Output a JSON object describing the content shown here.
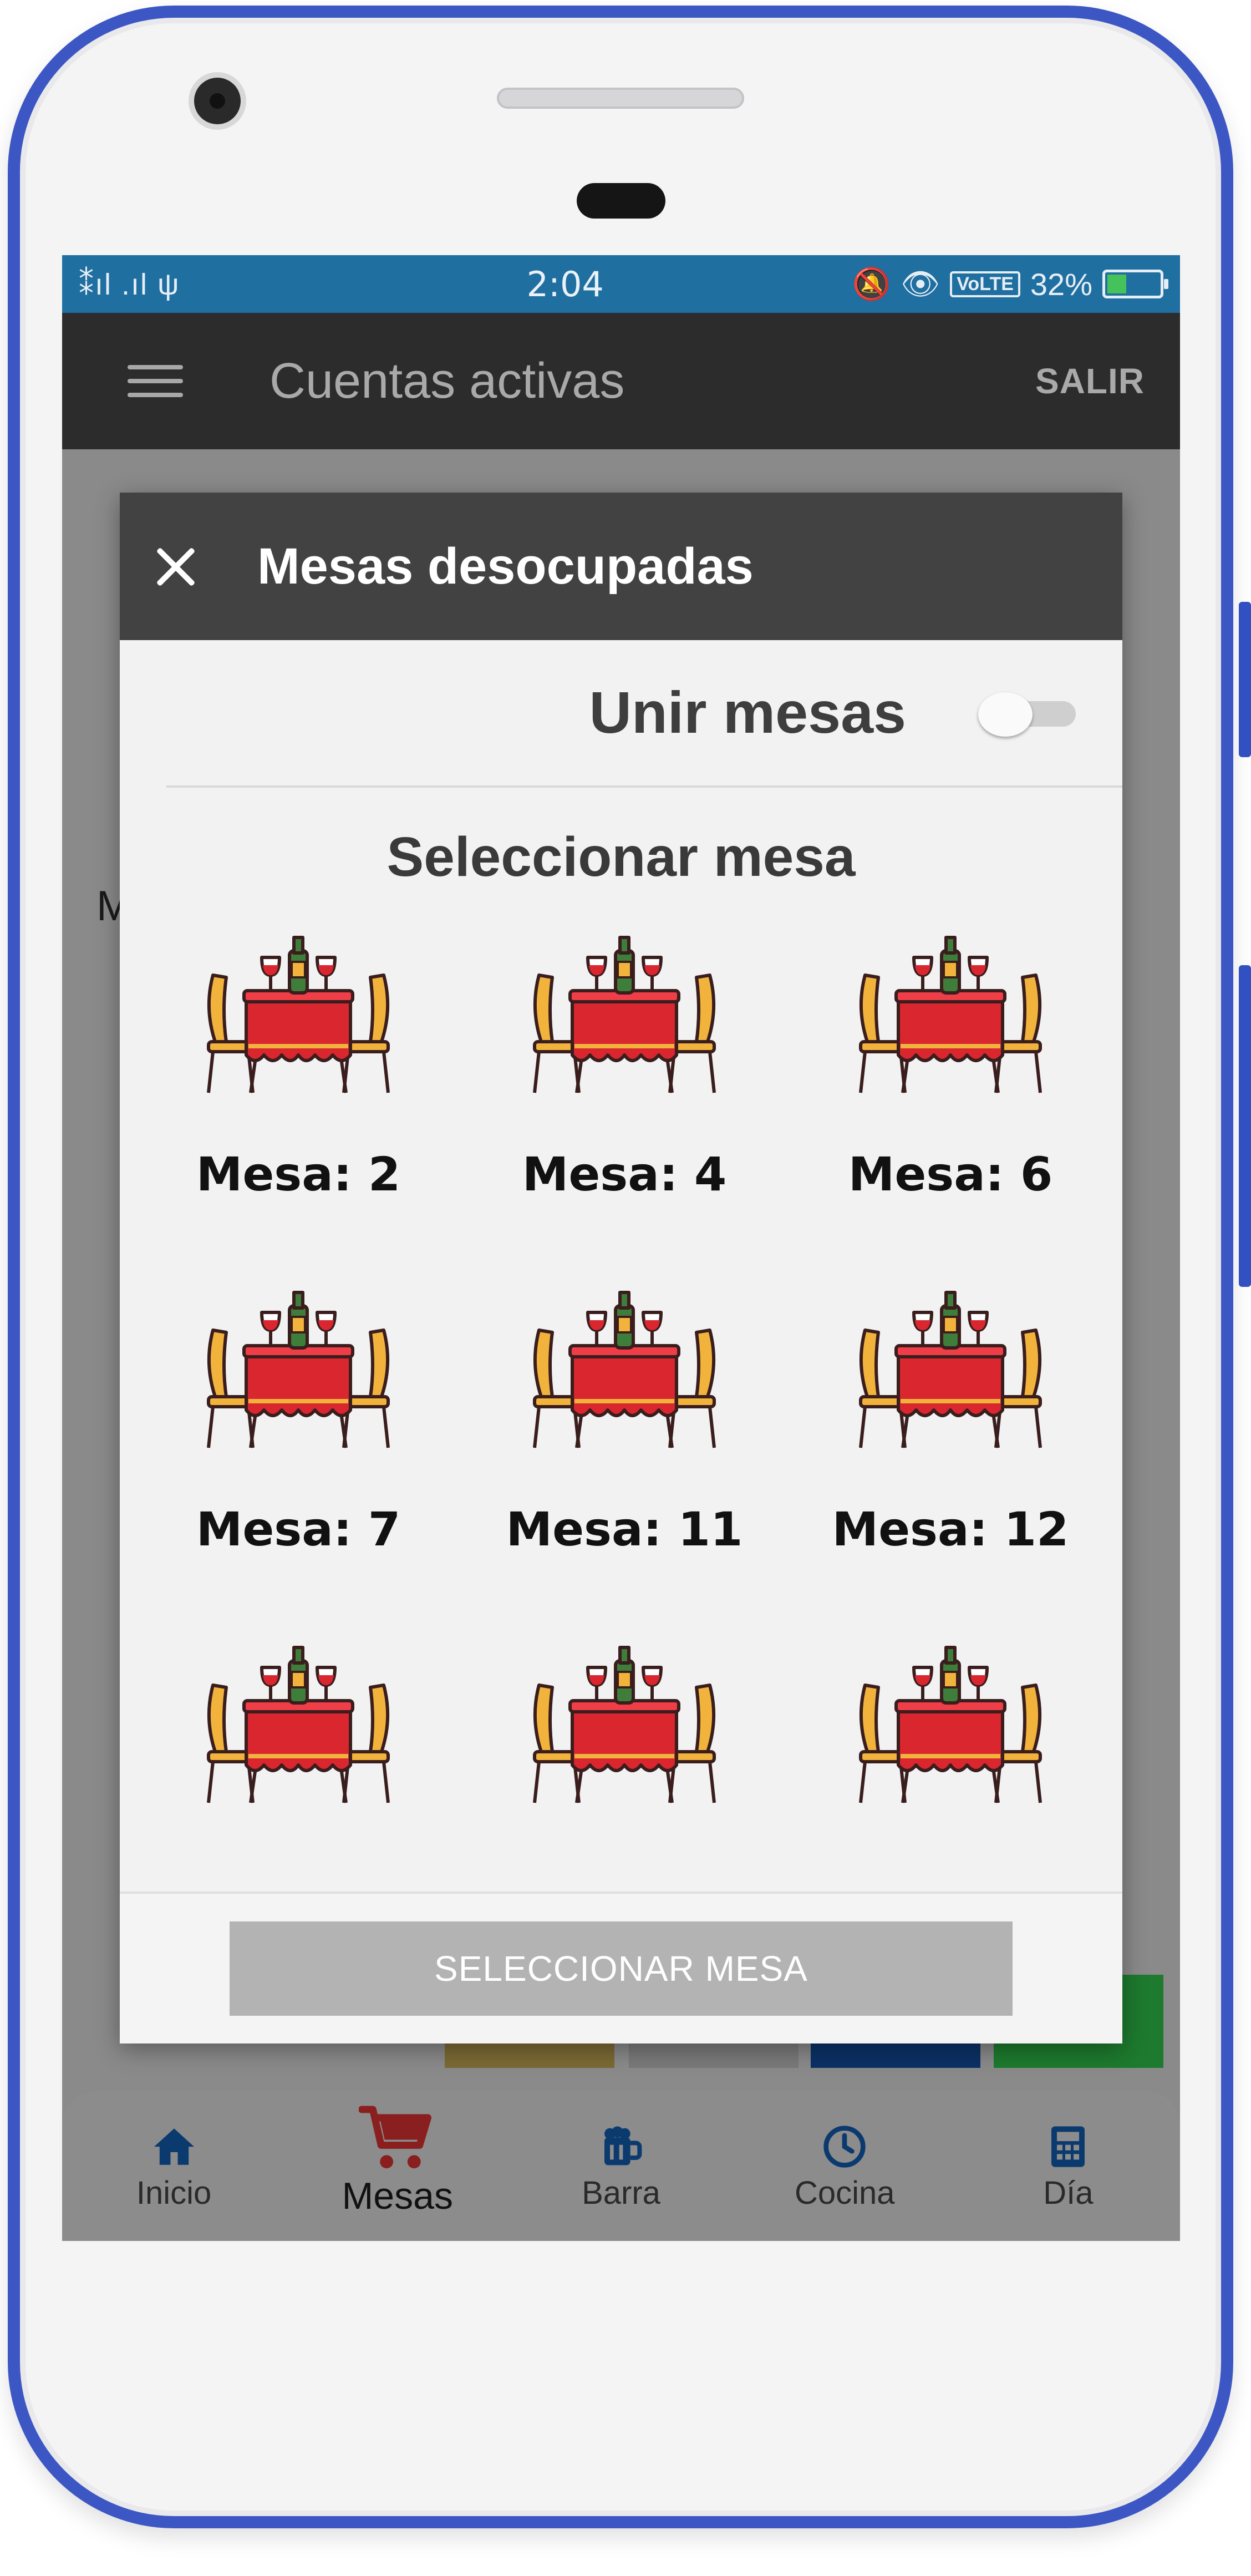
{
  "status_bar": {
    "left_icons": "⁑ıl .ıl ψ",
    "time": "2:04",
    "network": "VoLTE",
    "battery": "32%",
    "battery_level": 0.32
  },
  "app_bar": {
    "title": "Cuentas activas",
    "logout_label": "SALIR"
  },
  "background": {
    "visible_fragment": "M"
  },
  "dialog": {
    "title": "Mesas desocupadas",
    "join_tables_label": "Unir mesas",
    "join_tables_on": false,
    "section_heading": "Seleccionar mesa",
    "tables": [
      {
        "label": "Mesa: 2"
      },
      {
        "label": "Mesa: 4"
      },
      {
        "label": "Mesa: 6"
      },
      {
        "label": "Mesa: 7"
      },
      {
        "label": "Mesa: 11"
      },
      {
        "label": "Mesa: 12"
      },
      {
        "label": ""
      },
      {
        "label": ""
      },
      {
        "label": ""
      }
    ],
    "select_button_label": "SELECCIONAR MESA"
  },
  "bottom_nav": {
    "items": [
      {
        "label": "Inicio",
        "icon": "home-icon"
      },
      {
        "label": "Mesas",
        "icon": "cart-icon",
        "active": true
      },
      {
        "label": "Barra",
        "icon": "beer-mug-icon"
      },
      {
        "label": "Cocina",
        "icon": "clock-icon"
      },
      {
        "label": "Día",
        "icon": "calculator-icon"
      }
    ]
  },
  "colors": {
    "nav_active": "#8a1f1f",
    "nav_icon": "#0b3a6e",
    "dialog_header": "#424242",
    "status_bar": "#1f6fa1"
  }
}
